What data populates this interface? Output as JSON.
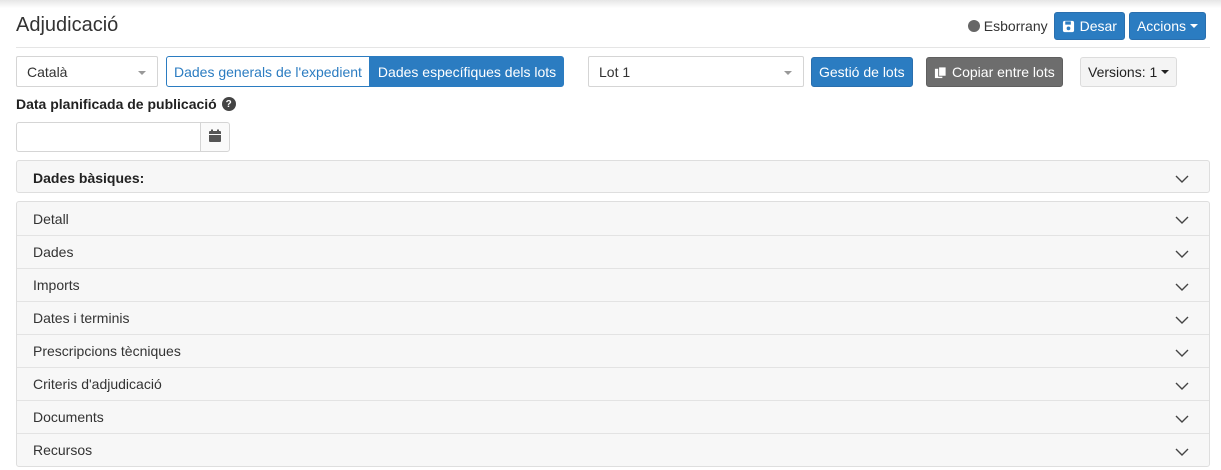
{
  "header": {
    "title": "Adjudicació",
    "status_label": "Esborrany",
    "save_label": "Desar",
    "actions_label": "Accions"
  },
  "toolbar": {
    "language_value": "Català",
    "tab_general": "Dades generals de l'expedient",
    "tab_specific": "Dades específiques dels lots",
    "lot_value": "Lot 1",
    "manage_lots_label": "Gestió de lots",
    "copy_lots_label": "Copiar entre lots",
    "versions_label": "Versions: 1"
  },
  "publication_date": {
    "label": "Data planificada de publicació",
    "value": ""
  },
  "basic_section": {
    "title": "Dades bàsiques:"
  },
  "sections": [
    {
      "label": "Detall"
    },
    {
      "label": "Dades"
    },
    {
      "label": "Imports"
    },
    {
      "label": "Dates i terminis"
    },
    {
      "label": "Prescripcions tècniques"
    },
    {
      "label": "Criteris d'adjudicació"
    },
    {
      "label": "Documents"
    },
    {
      "label": "Recursos"
    }
  ],
  "colors": {
    "primary": "#2b7cc1",
    "dark_button": "#6d6d6d",
    "panel_bg": "#f7f7f7"
  }
}
